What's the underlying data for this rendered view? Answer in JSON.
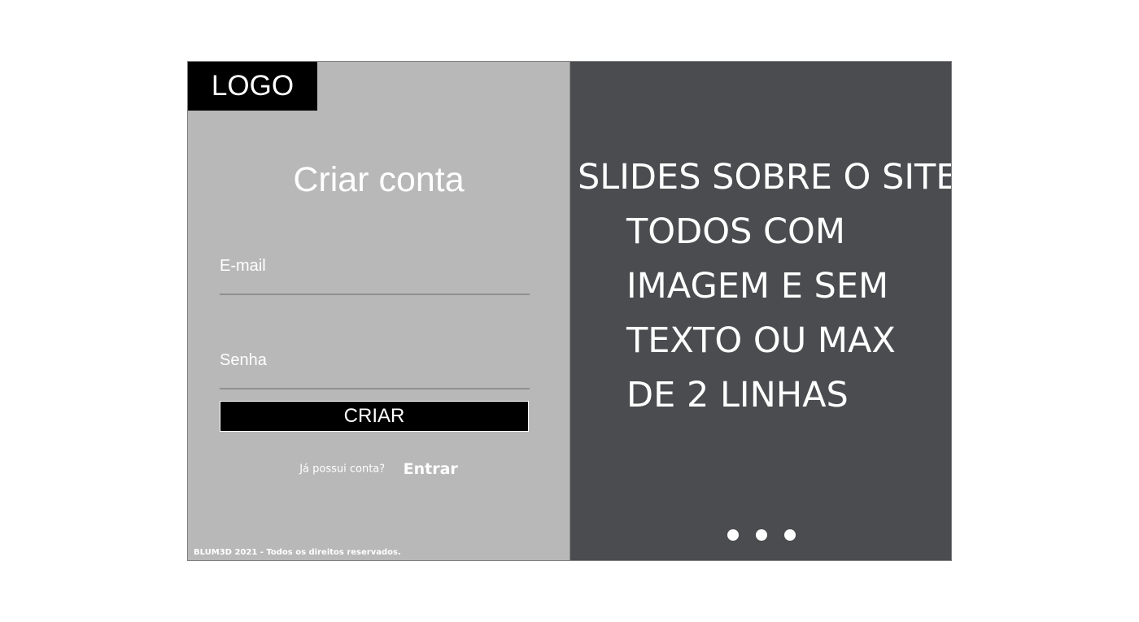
{
  "logo": {
    "text": "LOGO"
  },
  "form": {
    "title": "Criar conta",
    "email_label": "E-mail",
    "password_label": "Senha",
    "submit_label": "CRIAR",
    "login_prompt": "Já possui conta?",
    "login_link": "Entrar"
  },
  "footer": {
    "text": "BLUM3D 2021 - Todos os direitos reservados."
  },
  "slides": {
    "lines": [
      "SLIDES SOBRE O SITE",
      "TODOS COM",
      "IMAGEM E SEM",
      "TEXTO OU MAX",
      "DE 2 LINHAS"
    ],
    "dot_count": 3,
    "active_dot": 1
  },
  "colors": {
    "left_panel": "#b8b8b8",
    "right_panel": "#4a4c4f",
    "button": "#000000",
    "text": "#ffffff"
  }
}
